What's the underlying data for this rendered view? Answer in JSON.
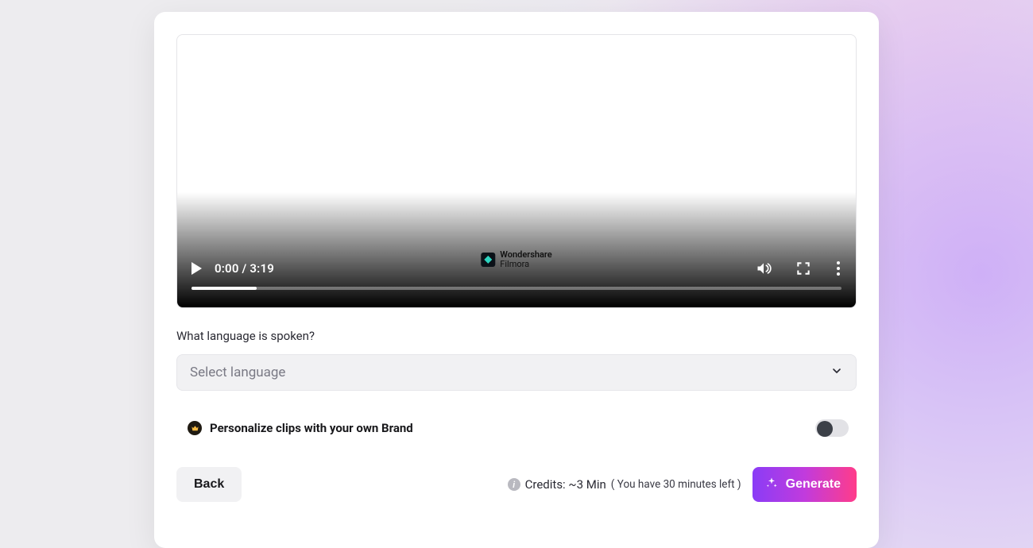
{
  "video": {
    "current_time": "0:00",
    "duration": "3:19",
    "progress_percent": 10,
    "watermark_line1": "Wondershare",
    "watermark_line2": "Filmora"
  },
  "form": {
    "language_label": "What language is spoken?",
    "language_placeholder": "Select language",
    "brand_toggle_label": "Personalize clips with your own Brand",
    "brand_toggle_on": false
  },
  "footer": {
    "back_label": "Back",
    "credits_label": "Credits: ~3 Min",
    "credits_remaining": "( You have 30 minutes left )",
    "generate_label": "Generate"
  }
}
